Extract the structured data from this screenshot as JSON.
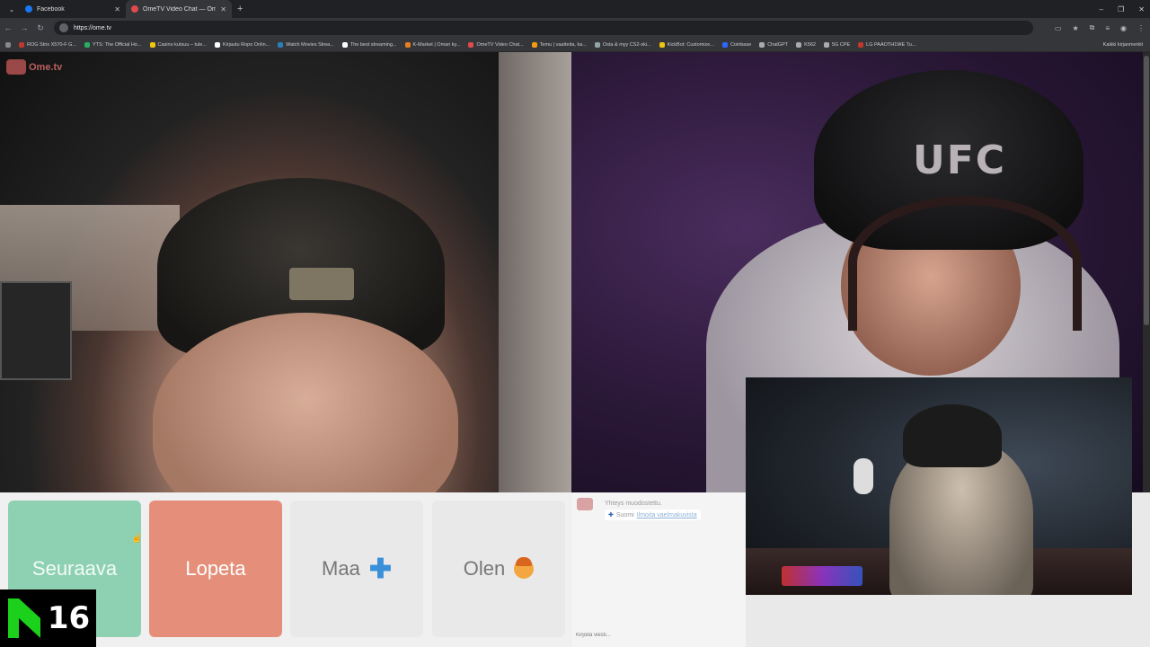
{
  "browser": {
    "tabs": [
      {
        "title": "Facebook",
        "color": "#1877f2",
        "active": false
      },
      {
        "title": "OmeTV Video Chat — Ome...",
        "color": "#e04a4a",
        "active": true
      }
    ],
    "url": "https://ome.tv",
    "bookmarks": [
      {
        "label": "ROG Strix X570-F G...",
        "color": "#c0392b"
      },
      {
        "label": "YTS: The Official Ho...",
        "color": "#27ae60"
      },
      {
        "label": "Casino kutsuu – tule...",
        "color": "#f1c40f"
      },
      {
        "label": "Kirjautu Ropo Onlin...",
        "color": "#ffffff"
      },
      {
        "label": "Watch Movies Strea...",
        "color": "#2980b9"
      },
      {
        "label": "The best streaming...",
        "color": "#ffffff"
      },
      {
        "label": "K-Market | Oman ky...",
        "color": "#e67e22"
      },
      {
        "label": "OmeTV Video Chat...",
        "color": "#e04a4a"
      },
      {
        "label": "Temu | vaatteita, ka...",
        "color": "#f39c12"
      },
      {
        "label": "Osta & myy CS2-ski...",
        "color": "#95a5a6"
      },
      {
        "label": "KickBot: Customize...",
        "color": "#f1c40f"
      },
      {
        "label": "Coinbase",
        "color": "#2e66ff"
      },
      {
        "label": "ChatGPT",
        "color": "#aaaaaa"
      },
      {
        "label": "K562",
        "color": "#aaaaaa"
      },
      {
        "label": "5G CPE",
        "color": "#aaaaaa"
      },
      {
        "label": "LG PAAOTH1WE Tu...",
        "color": "#c0392b"
      }
    ],
    "bookmarks_right": "Kaikki kirjanmerkit"
  },
  "site": {
    "logo_text": "Ome.tv"
  },
  "controls": {
    "next_label": "Seuraava",
    "stop_label": "Lopeta",
    "country_label": "Maa",
    "iam_label": "Olen"
  },
  "chat": {
    "status_line": "Yhteys muodostettu.",
    "country_name": "Suomi",
    "link_text": "Ilmoita vaelmakuvista",
    "input_placeholder": "Kirjoita viesti..."
  },
  "overlay": {
    "age_rating": "16"
  }
}
